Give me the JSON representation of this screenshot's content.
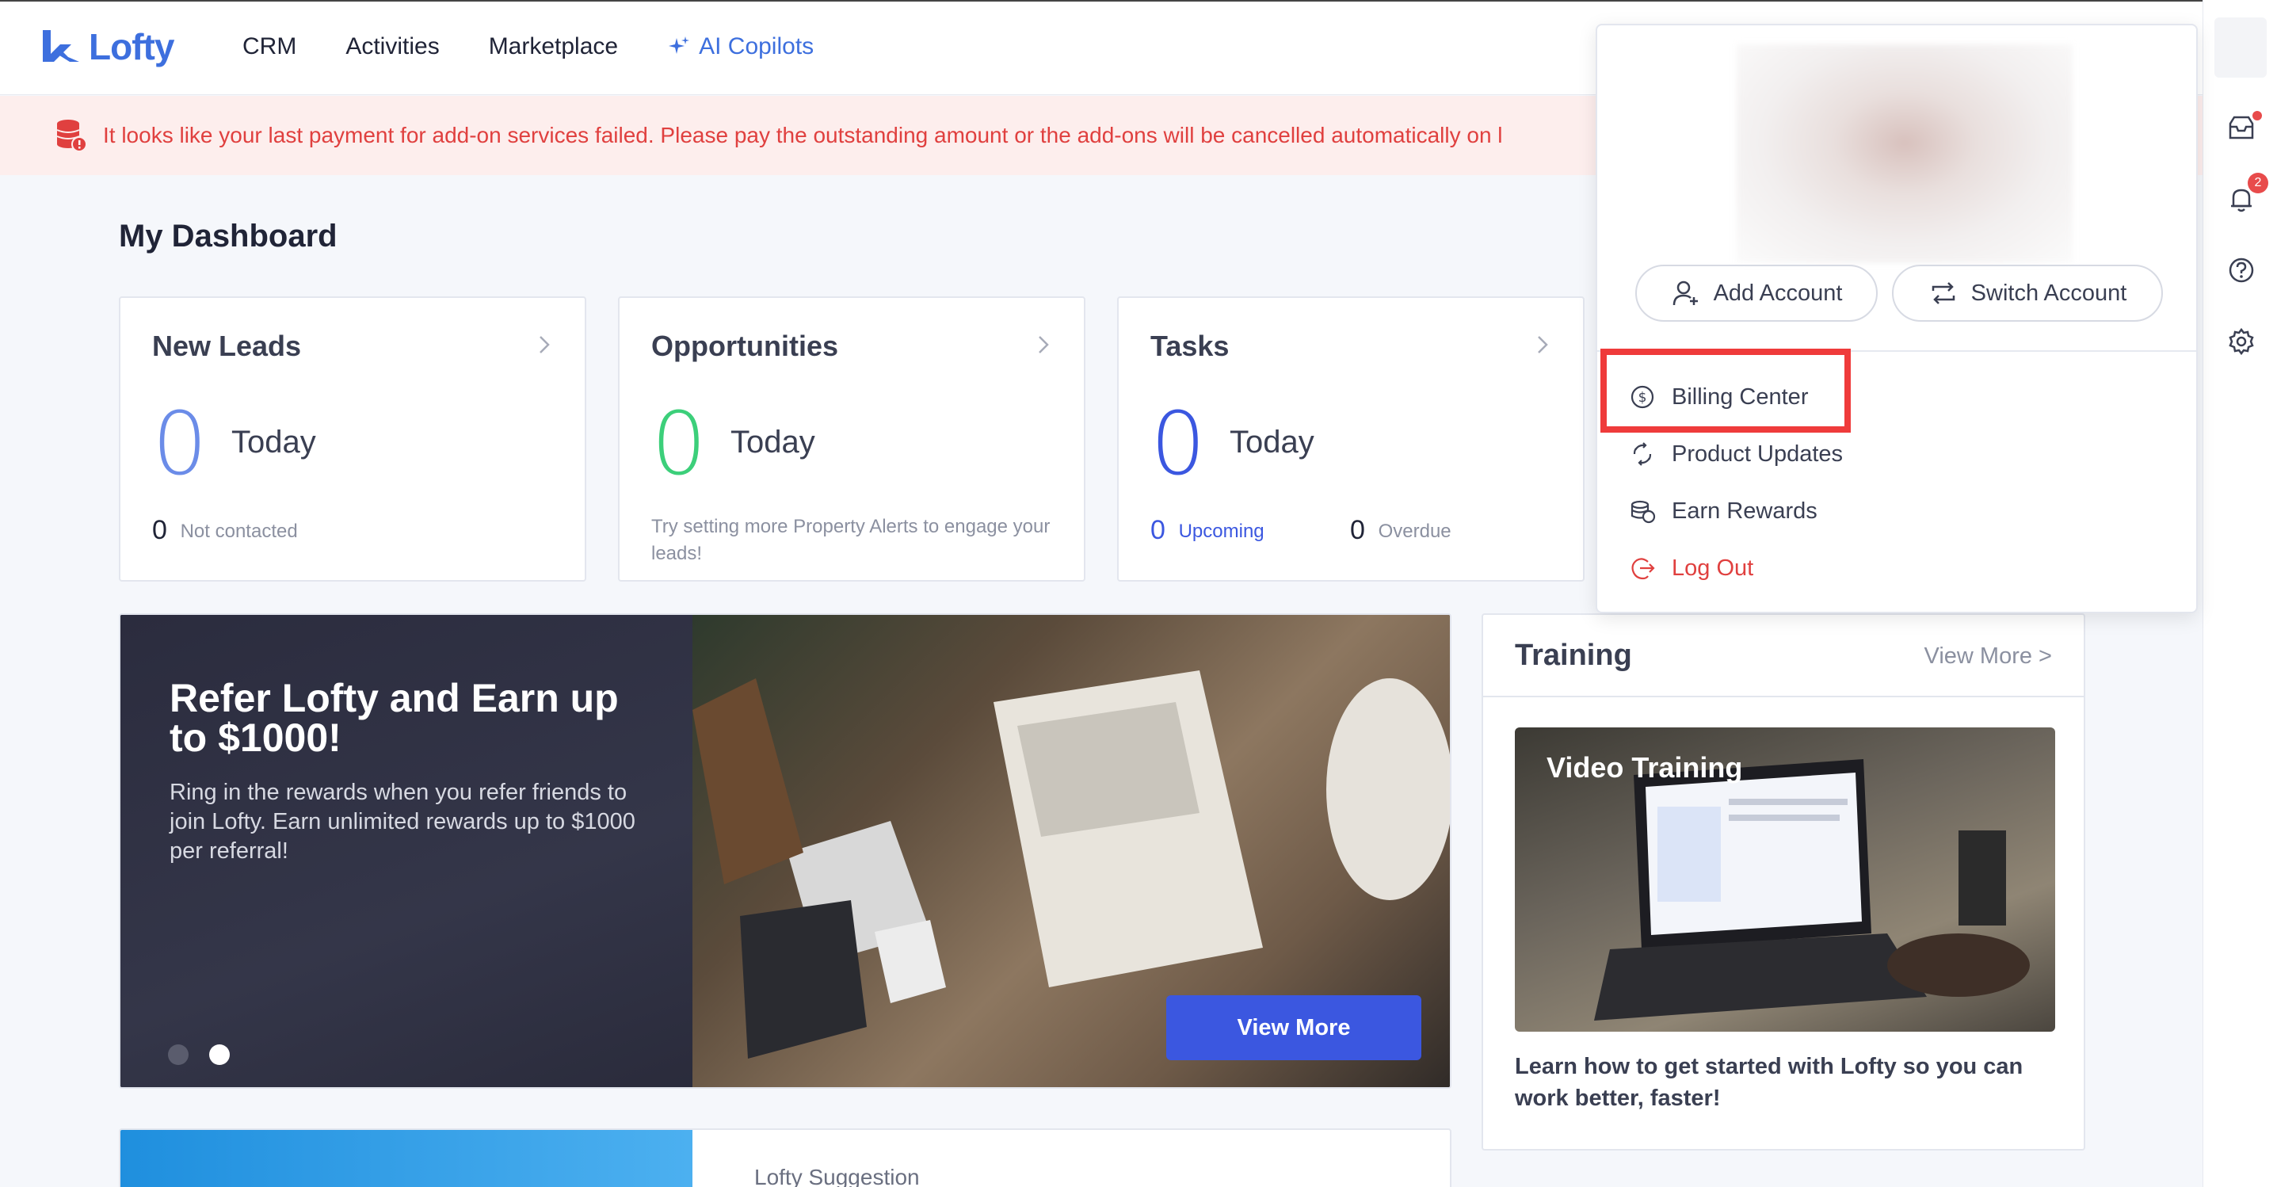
{
  "brand": {
    "name": "Lofty",
    "accent": "#3d6fde"
  },
  "nav": {
    "items": [
      "CRM",
      "Activities",
      "Marketplace"
    ],
    "ai_label": "AI Copilots"
  },
  "banner": {
    "text": "It looks like your last payment for add-on services failed. Please pay the outstanding amount or the add-ons will be cancelled automatically on l"
  },
  "dashboard": {
    "title": "My Dashboard",
    "cards": [
      {
        "title": "New Leads",
        "value": "0",
        "period": "Today",
        "foot_value": "0",
        "foot_label": "Not contacted",
        "color": "#6b8ce8"
      },
      {
        "title": "Opportunities",
        "value": "0",
        "period": "Today",
        "foot_text": "Try setting more Property Alerts to engage your leads!",
        "color": "#3ccf7a"
      },
      {
        "title": "Tasks",
        "value": "0",
        "period": "Today",
        "upcoming_value": "0",
        "upcoming_label": "Upcoming",
        "overdue_value": "0",
        "overdue_label": "Overdue",
        "color": "#3b57e0"
      }
    ]
  },
  "hero": {
    "title": "Refer Lofty and Earn up to $1000!",
    "subtitle": "Ring in the rewards when you refer friends to join Lofty. Earn unlimited rewards up to $1000 per referral!",
    "button": "View More"
  },
  "training": {
    "title": "Training",
    "more": "View More >",
    "image_label": "Video Training",
    "description": "Learn how to get started with Lofty so you can work better, faster!"
  },
  "bottom": {
    "suggestion_label": "Lofty Suggestion"
  },
  "account_menu": {
    "add_account": "Add Account",
    "switch_account": "Switch Account",
    "items": [
      "Billing Center",
      "Product Updates",
      "Earn Rewards"
    ],
    "logout": "Log Out"
  },
  "rail": {
    "notification_count": "2"
  },
  "colors": {
    "alert": "#e0403f",
    "highlight": "#ef3b3b",
    "primary_button": "#3b57e0"
  }
}
